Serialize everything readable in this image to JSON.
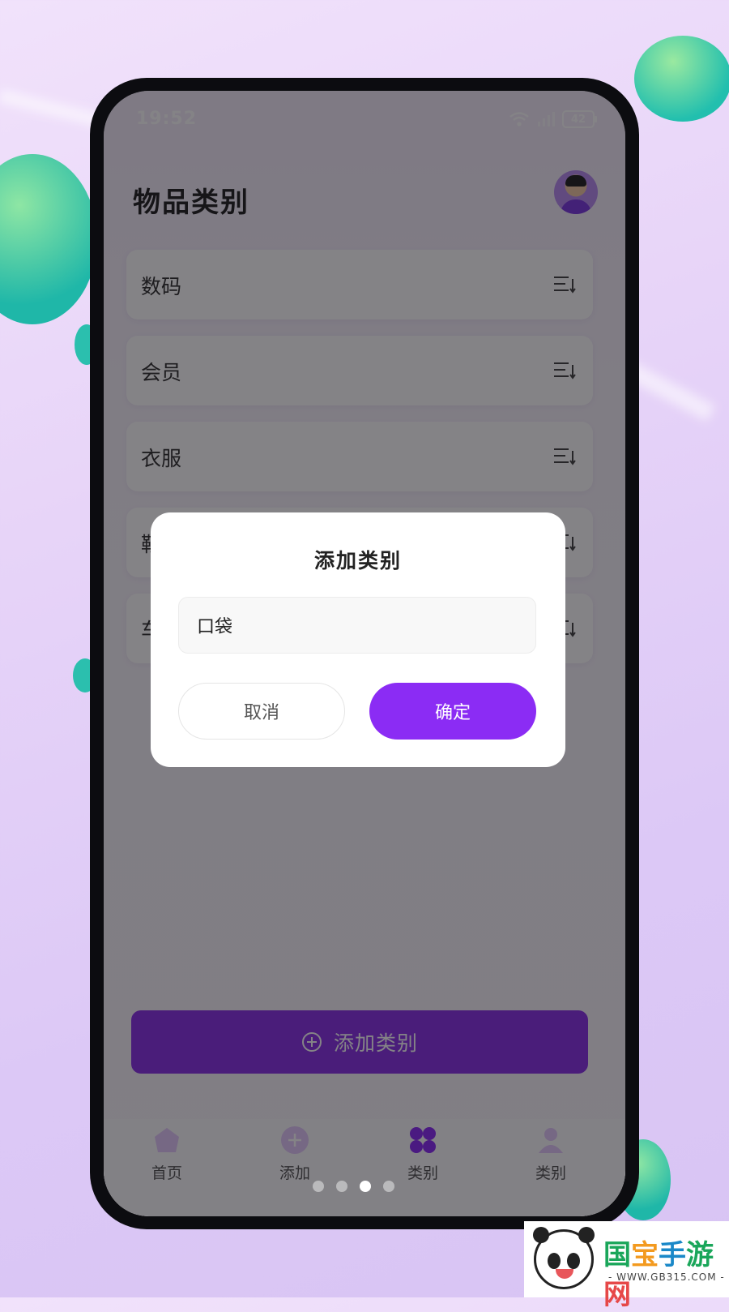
{
  "status_bar": {
    "time": "19:52",
    "battery": "42"
  },
  "header": {
    "title": "物品类别"
  },
  "categories": [
    {
      "label": "数码"
    },
    {
      "label": "会员"
    },
    {
      "label": "衣服"
    },
    {
      "label": "鞋"
    },
    {
      "label": "车"
    }
  ],
  "add_button": {
    "label": "添加类别"
  },
  "tabbar": {
    "items": [
      {
        "label": "首页"
      },
      {
        "label": "添加"
      },
      {
        "label": "类别"
      },
      {
        "label": "类别"
      }
    ]
  },
  "dialog": {
    "title": "添加类别",
    "input_value": "口袋",
    "cancel_label": "取消",
    "confirm_label": "确定"
  },
  "watermark": {
    "name_1": "国",
    "name_2": "宝",
    "name_3": "手",
    "name_4": "游",
    "name_5": "网",
    "url": "- WWW.GB315.COM -"
  },
  "colors": {
    "accent": "#8b2cf4",
    "overlay": "#0a080e"
  }
}
